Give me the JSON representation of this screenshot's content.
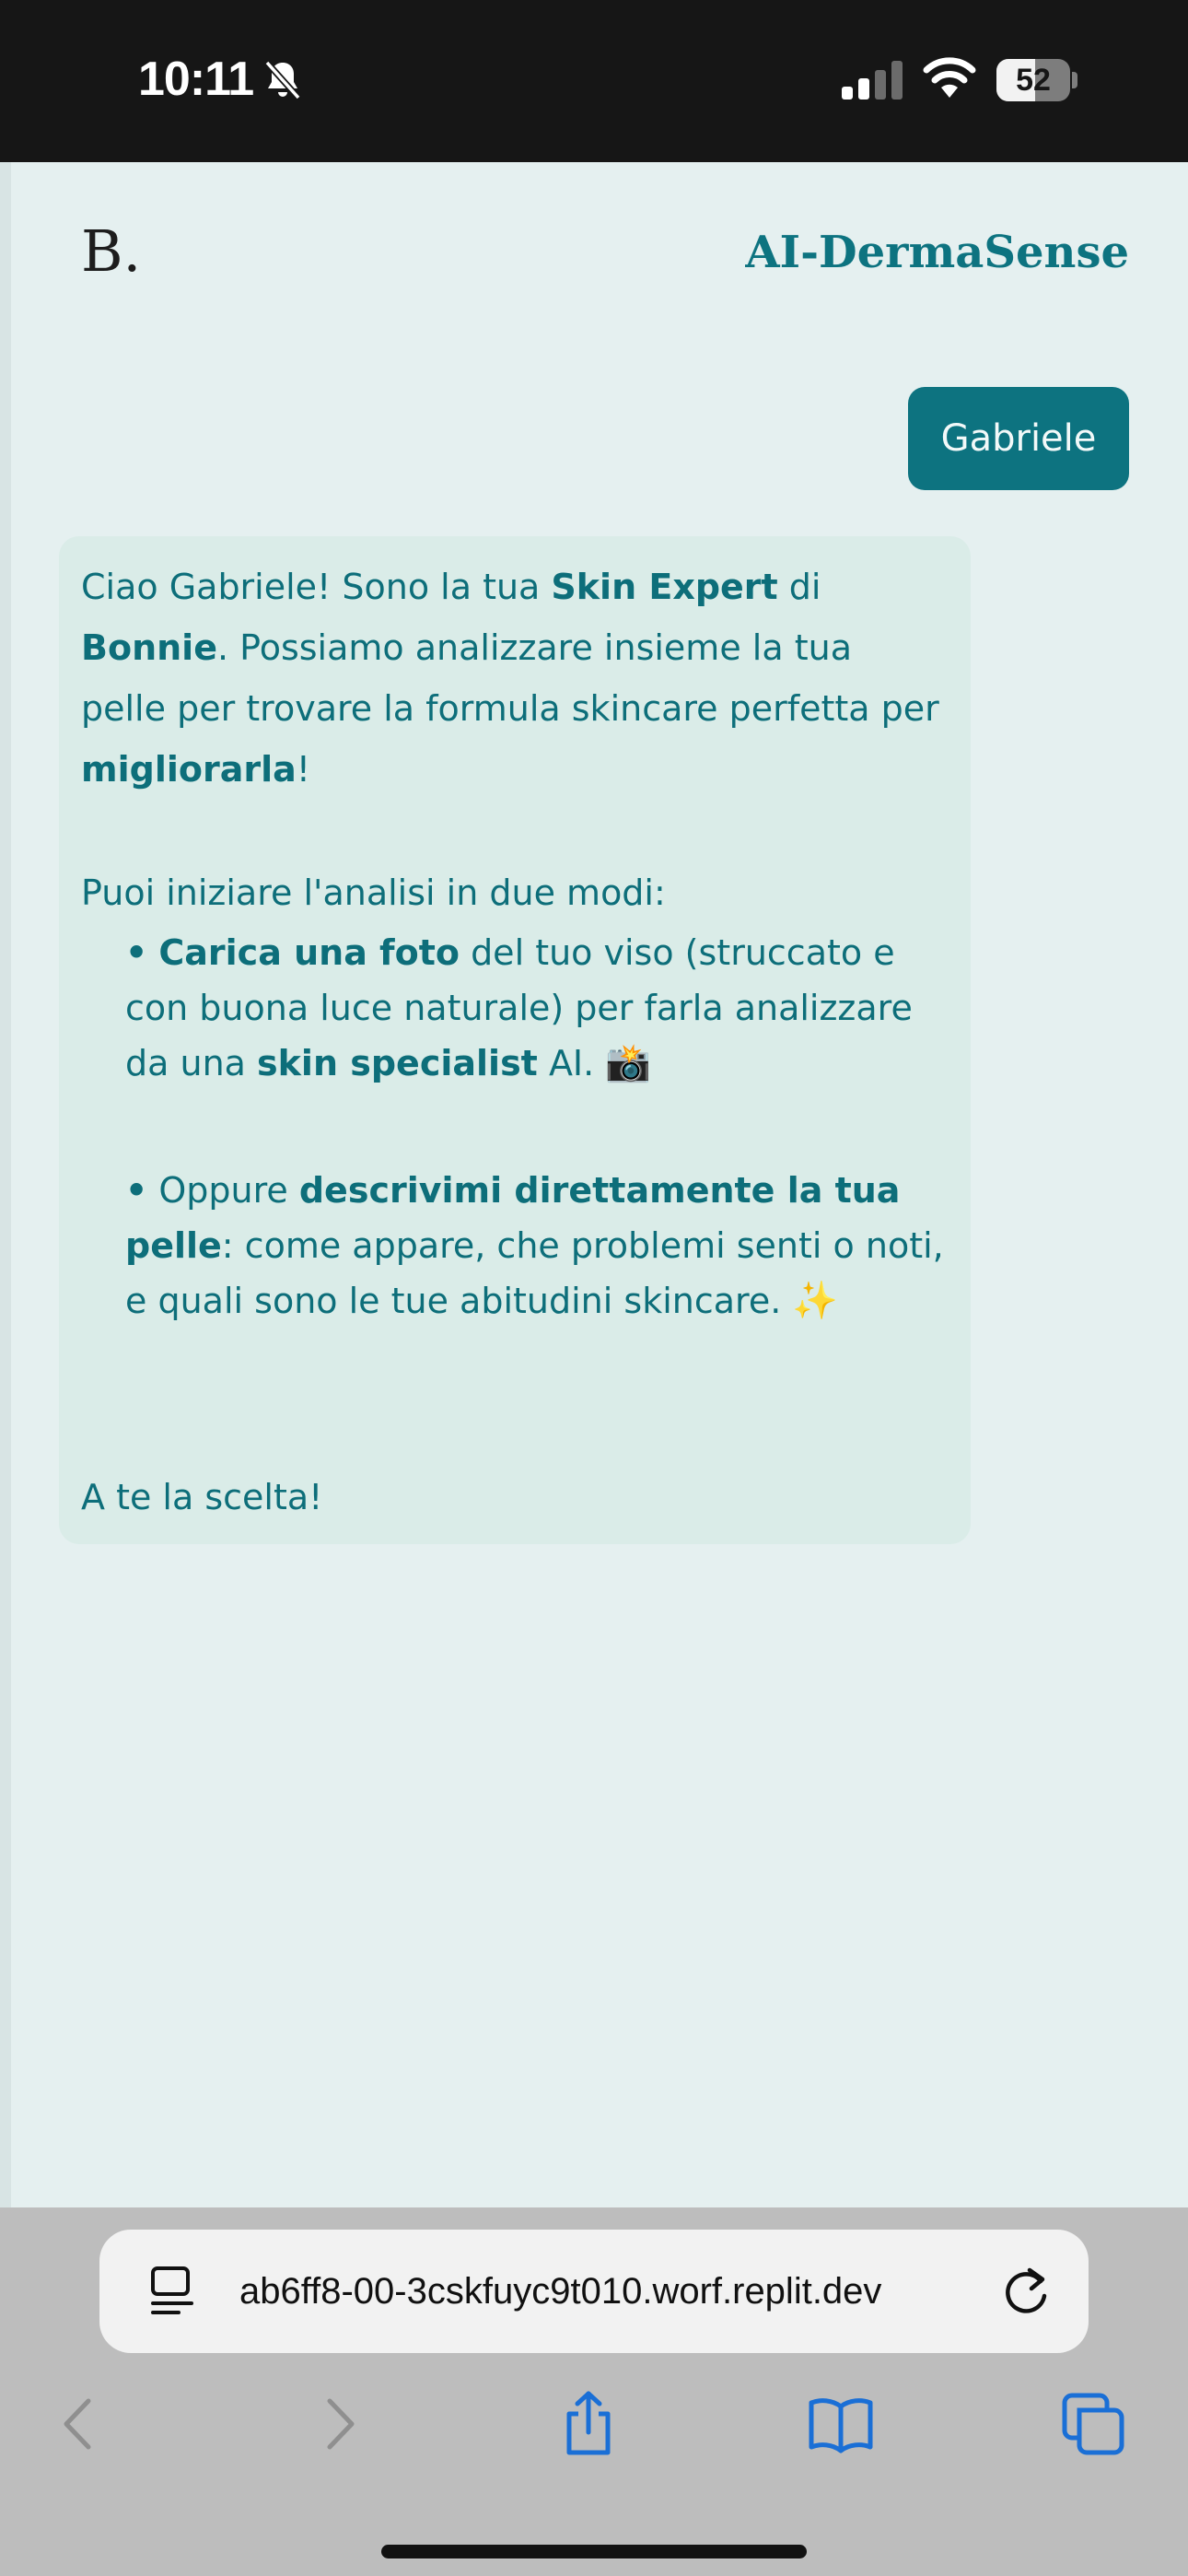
{
  "status_bar": {
    "time": "10:11",
    "battery_level": "52",
    "battery_fraction": 0.52,
    "icons": [
      "bell-slash-icon",
      "cellular-signal-icon",
      "wifi-icon",
      "battery-icon"
    ]
  },
  "header": {
    "logo": "B.",
    "brand": "AI-DermaSense"
  },
  "chat": {
    "user_message": "Gabriele",
    "assistant": {
      "intro_1": "Ciao Gabriele! Sono la tua ",
      "intro_bold_1": "Skin Expert",
      "intro_2": " di ",
      "intro_bold_2": "Bonnie",
      "intro_3": ". Possiamo analizzare insieme la tua pelle per trovare la formula skincare perfetta per ",
      "intro_bold_3": "migliorarla",
      "intro_4": "!",
      "options_label": "Puoi iniziare l'analisi in due modi:",
      "option_1_bullet": "•",
      "option_1_bold": "Carica una foto",
      "option_1_text": " del tuo viso (struccato e con buona luce naturale) per farla analizzare da una ",
      "option_1_bold_2": "skin specialist",
      "option_1_text_2": " AI. ",
      "option_1_emoji": "📸",
      "option_2_bullet": "•",
      "option_2_text": " Oppure ",
      "option_2_bold": "descrivimi direttamente la tua pelle",
      "option_2_text_2": ": come appare, che problemi senti o noti, e quali sono le tue abitudini skincare. ",
      "option_2_emoji": "✨",
      "closing": "A te la scelta!"
    }
  },
  "browser": {
    "url": "ab6ff8-00-3cskfuyc9t010.worf.replit.dev",
    "icons": [
      "page-menu-icon",
      "reload-icon",
      "back-icon",
      "forward-icon",
      "share-icon",
      "bookmarks-icon",
      "tabs-icon"
    ],
    "accent": "#1a6fd6"
  },
  "colors": {
    "brand_teal": "#0d7380",
    "page_bg": "#e5f0f0",
    "assistant_bg": "#daece8"
  }
}
